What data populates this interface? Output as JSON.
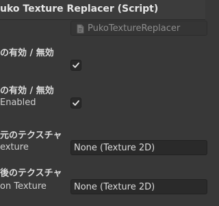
{
  "header": {
    "title": "uko Texture Replacer (Script)"
  },
  "script_field": {
    "value": "PukoTextureReplacer",
    "icon": "script-file-icon"
  },
  "sections": [
    {
      "title": "の有効 / 無効",
      "checked": true
    },
    {
      "title": "の有効 / 無効",
      "label": "Enabled",
      "checked": true
    },
    {
      "title": "元のテクスチャ",
      "label": "exture",
      "value": "None (Texture 2D)"
    },
    {
      "title": "後のテクスチャ",
      "label": "on Texture",
      "value": "None (Texture 2D)"
    }
  ],
  "colors": {
    "background": "#383838",
    "header": "#3c3c3c",
    "field": "#2a2a2a",
    "text": "#d2d2d2"
  }
}
